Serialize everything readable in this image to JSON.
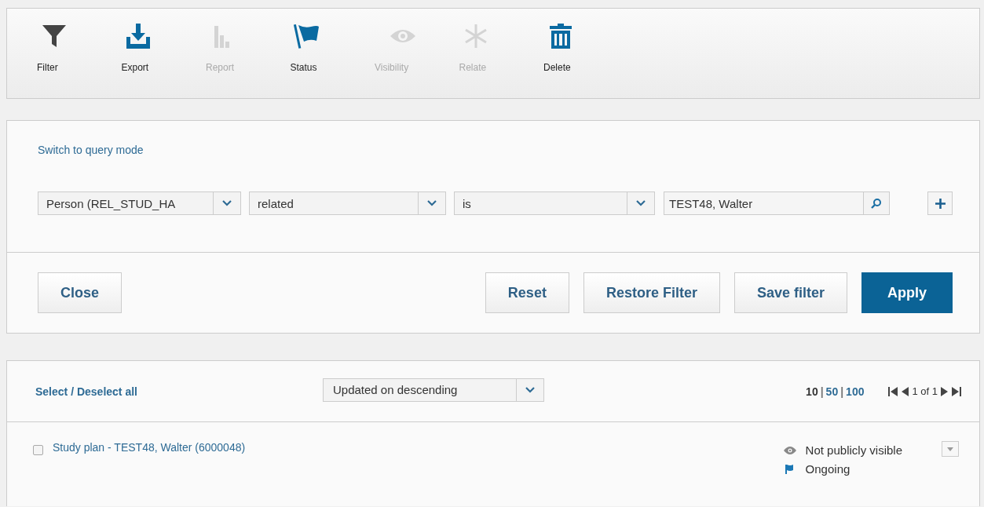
{
  "toolbar": [
    {
      "kind": "filter",
      "label": "Filter",
      "disabled": false
    },
    {
      "kind": "export",
      "label": "Export",
      "disabled": false
    },
    {
      "kind": "report",
      "label": "Report",
      "disabled": true
    },
    {
      "kind": "status",
      "label": "Status",
      "disabled": false
    },
    {
      "kind": "visibility",
      "label": "Visibility",
      "disabled": true
    },
    {
      "kind": "relate",
      "label": "Relate",
      "disabled": true
    },
    {
      "kind": "delete",
      "label": "Delete",
      "disabled": false
    }
  ],
  "filter": {
    "mode_link": "Switch to query mode",
    "condition": {
      "field": "Person (REL_STUD_HA",
      "operator": "related",
      "comparison": "is",
      "value": "TEST48, Walter"
    },
    "buttons": [
      {
        "label": "Close",
        "primary": false
      },
      {
        "label": "Reset",
        "primary": false
      },
      {
        "label": "Restore Filter",
        "primary": false
      },
      {
        "label": "Save filter",
        "primary": false
      },
      {
        "label": "Apply",
        "primary": true
      }
    ]
  },
  "results": {
    "select_all": "Select / Deselect all",
    "sort": "Updated on descending",
    "page_sizes": [
      {
        "label": "10",
        "selected": true
      },
      {
        "label": "50",
        "selected": false
      },
      {
        "label": "100",
        "selected": false
      }
    ],
    "page_size_separator": "|",
    "page_info": "1 of 1",
    "rows": [
      {
        "title": "Study plan - TEST48, Walter (6000048)",
        "checked": false,
        "visibility": "Not publicly visible",
        "status": "Ongoing"
      }
    ]
  }
}
